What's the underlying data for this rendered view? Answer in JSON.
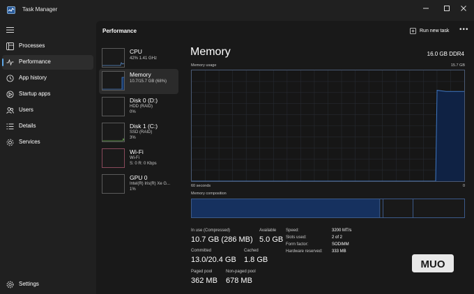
{
  "window": {
    "title": "Task Manager",
    "controls": [
      "minimize",
      "maximize",
      "close"
    ]
  },
  "nav": {
    "items": [
      {
        "label": "Processes",
        "icon": "processes-icon"
      },
      {
        "label": "Performance",
        "icon": "performance-icon",
        "active": true
      },
      {
        "label": "App history",
        "icon": "app-history-icon"
      },
      {
        "label": "Startup apps",
        "icon": "startup-apps-icon"
      },
      {
        "label": "Users",
        "icon": "users-icon"
      },
      {
        "label": "Details",
        "icon": "details-icon"
      },
      {
        "label": "Services",
        "icon": "services-icon"
      }
    ],
    "settings_label": "Settings"
  },
  "header": {
    "title": "Performance",
    "run_new_task": "Run new task"
  },
  "devices": [
    {
      "name": "CPU",
      "line1": "42%  1.41 GHz",
      "line2": ""
    },
    {
      "name": "Memory",
      "line1": "10.7/15.7 GB (68%)",
      "line2": "",
      "selected": true
    },
    {
      "name": "Disk 0 (D:)",
      "line1": "HDD (RAID)",
      "line2": "0%"
    },
    {
      "name": "Disk 1 (C:)",
      "line1": "SSD (RAID)",
      "line2": "3%"
    },
    {
      "name": "Wi-Fi",
      "line1": "Wi-Fi",
      "line2": "S: 0 R: 0 Kbps"
    },
    {
      "name": "GPU 0",
      "line1": "Intel(R) Iris(R) Xe G...",
      "line2": "1%"
    }
  ],
  "memory": {
    "title": "Memory",
    "capacity": "16.0 GB DDR4",
    "usage_label": "Memory usage",
    "usage_max": "15.7 GB",
    "x_left": "60 seconds",
    "x_right": "0",
    "composition_label": "Memory composition",
    "composition": {
      "in_use": 0.69,
      "modified": 0.012,
      "standby": 0.11
    },
    "usage_history": [
      0,
      0.85,
      0.82,
      0.81,
      0.81
    ],
    "stats": {
      "in_use_label": "In use (Compressed)",
      "in_use_value": "10.7 GB (286 MB)",
      "available_label": "Available",
      "available_value": "5.0 GB",
      "committed_label": "Committed",
      "committed_value": "13.0/20.4 GB",
      "cached_label": "Cached",
      "cached_value": "1.8 GB",
      "paged_label": "Paged pool",
      "paged_value": "362 MB",
      "nonpaged_label": "Non-paged pool",
      "nonpaged_value": "678 MB"
    },
    "specs": [
      {
        "key": "Speed:",
        "value": "3200 MT/s"
      },
      {
        "key": "Slots used:",
        "value": "2 of 2"
      },
      {
        "key": "Form factor:",
        "value": "SODIMM"
      },
      {
        "key": "Hardware reserved:",
        "value": "333 MB"
      }
    ]
  },
  "watermark": "MUO",
  "colors": {
    "accent": "#5fa8e8",
    "memory_line": "#3f77c2",
    "memory_fill": "#0f2244"
  }
}
